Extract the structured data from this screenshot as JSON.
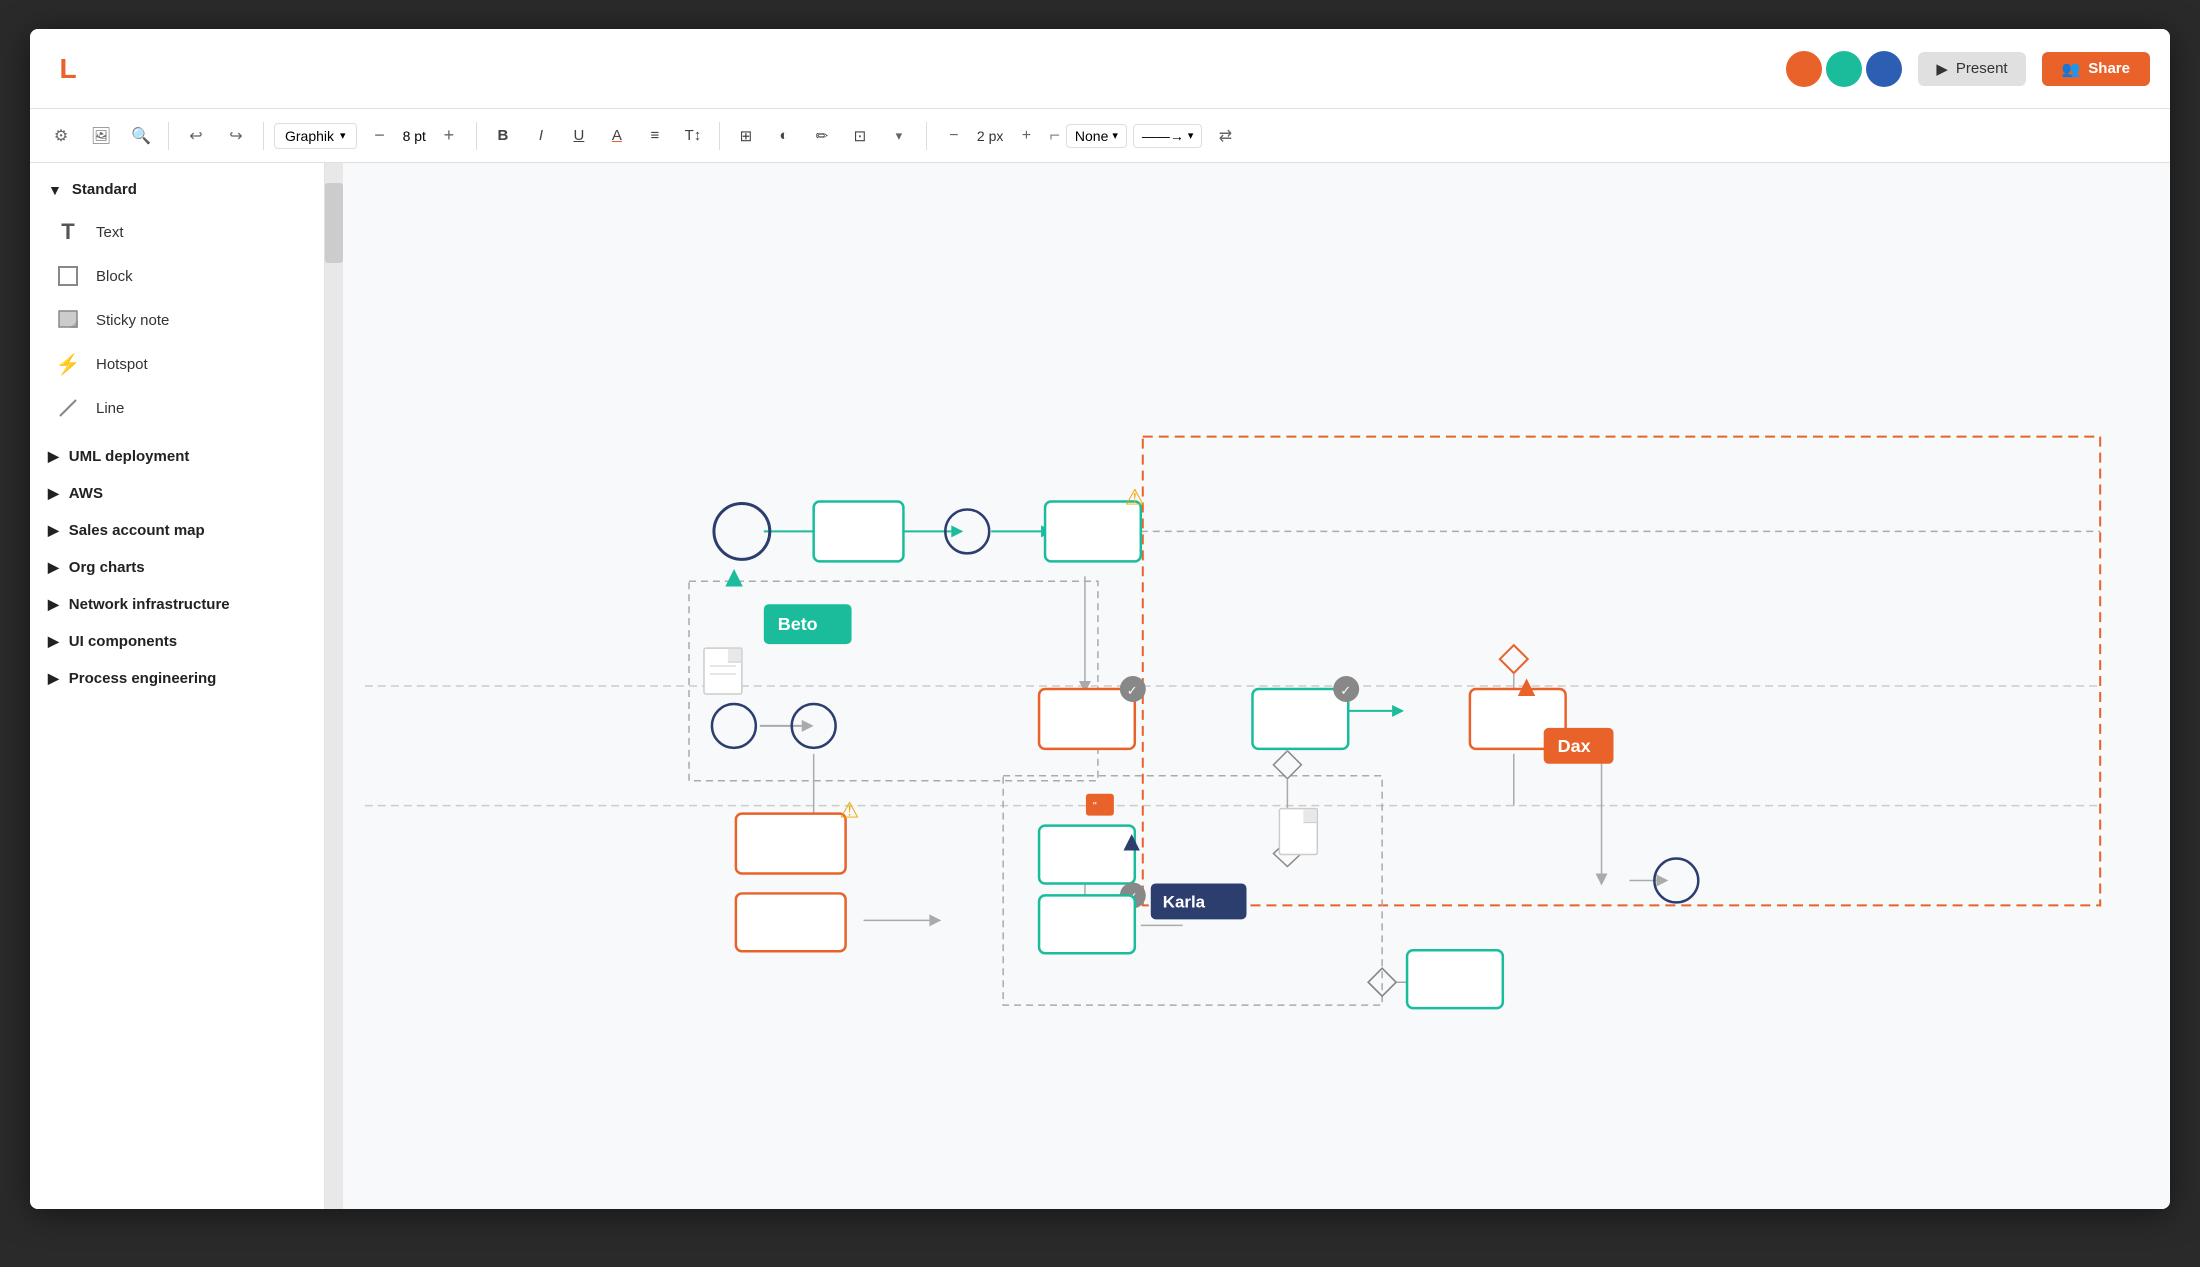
{
  "app": {
    "logo": "L",
    "logo_color": "#e8622a"
  },
  "header": {
    "present_label": "Present",
    "share_label": "Share",
    "avatars": [
      {
        "color": "#e8622a",
        "initial": ""
      },
      {
        "color": "#1abc9c",
        "initial": ""
      },
      {
        "color": "#2c5fb3",
        "initial": ""
      }
    ]
  },
  "toolbar": {
    "font_name": "Graphik",
    "font_size": "8 pt",
    "bold": "B",
    "italic": "I",
    "underline": "U",
    "font_color": "A",
    "align": "≡",
    "text_type": "T↕",
    "grid": "⊞",
    "fill": "◐",
    "pen": "✏",
    "image": "⊡",
    "px_label": "2 px",
    "line_style": "None",
    "arrow_style": "→",
    "swap": "⇄"
  },
  "sidebar": {
    "standard_section": {
      "label": "Standard",
      "expanded": true,
      "items": [
        {
          "label": "Text",
          "icon": "T"
        },
        {
          "label": "Block",
          "icon": "□"
        },
        {
          "label": "Sticky note",
          "icon": "▣"
        },
        {
          "label": "Hotspot",
          "icon": "⚡"
        },
        {
          "label": "Line",
          "icon": "╱"
        }
      ]
    },
    "collapsed_sections": [
      {
        "label": "UML deployment"
      },
      {
        "label": "AWS"
      },
      {
        "label": "Sales account map"
      },
      {
        "label": "Org charts"
      },
      {
        "label": "Network infrastructure"
      },
      {
        "label": "UI components"
      },
      {
        "label": "Process engineering"
      }
    ]
  },
  "diagram": {
    "labels": {
      "beto": "Beto",
      "dax": "Dax",
      "karla": "Karla"
    }
  }
}
